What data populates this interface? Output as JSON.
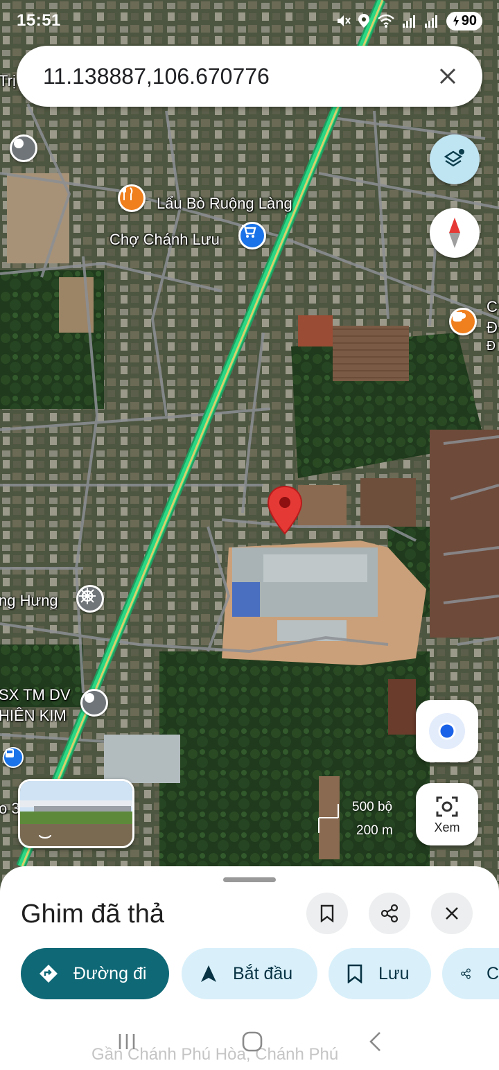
{
  "status_bar": {
    "time": "15:51",
    "battery": "90",
    "icons": [
      "mute-icon",
      "location-icon",
      "wifi-icon",
      "signal-icon",
      "signal-icon",
      "battery-charging-icon"
    ]
  },
  "search": {
    "value": "11.138887,106.670776"
  },
  "map": {
    "labels": {
      "restaurant": "Lẩu Bò Ruộng Làng",
      "market": "Chợ Chánh Lưu",
      "left_top": "Trị",
      "right_top_1": "C",
      "right_top_2": "Đ",
      "right_top_3": "Đ",
      "left_mid": "ng Hưng",
      "company_1": "SX TM DV",
      "company_2": "HIÊN KIM",
      "left_bottom": "o 3"
    },
    "scale": {
      "imperial": "500 bộ",
      "metric": "200 m"
    },
    "colors": {
      "road_highlight": "#27c47a",
      "pin": "#e53935",
      "poi_food": "#f07f1e",
      "poi_shop": "#1a73e8",
      "poi_gray": "#70757a"
    }
  },
  "buttons": {
    "view_label": "Xem"
  },
  "sheet": {
    "title": "Ghim đã thả",
    "chips": [
      {
        "label": "Đường đi",
        "icon": "directions-icon"
      },
      {
        "label": "Bắt đầu",
        "icon": "navigation-arrow-icon"
      },
      {
        "label": "Lưu",
        "icon": "bookmark-icon"
      },
      {
        "label": "C",
        "icon": "share-icon"
      }
    ],
    "ghost_address": "Gần Chánh Phú Hòa, Chánh Phú"
  }
}
